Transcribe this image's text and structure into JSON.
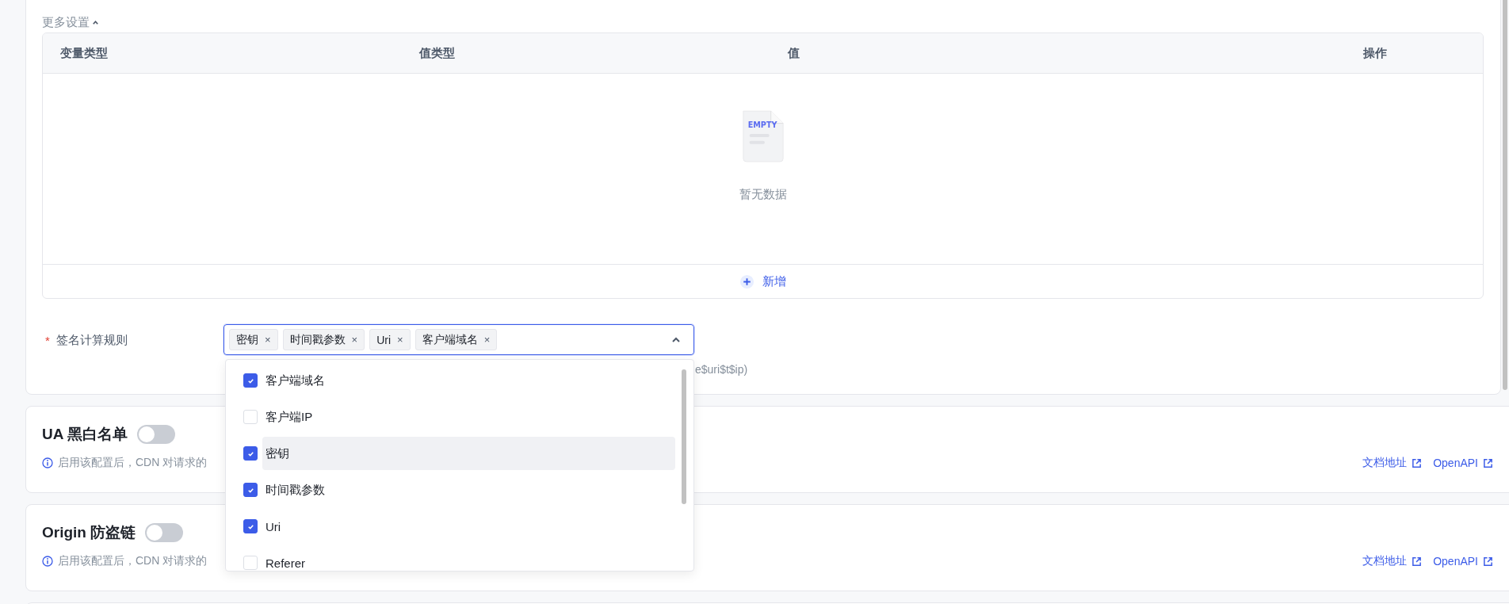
{
  "more_settings": {
    "label": "更多设置",
    "expanded": true
  },
  "table": {
    "columns": [
      "变量类型",
      "值类型",
      "值",
      "操作"
    ],
    "empty_text": "暂无数据",
    "empty_icon_text": "EMPTY",
    "add_label": "新增"
  },
  "signature_rule": {
    "required_mark": "*",
    "label": "签名计算规则",
    "tags": [
      {
        "label": "密钥",
        "remove": "×"
      },
      {
        "label": "时间戳参数",
        "remove": "×"
      },
      {
        "label": "Uri",
        "remove": "×"
      },
      {
        "label": "客户端域名",
        "remove": "×"
      }
    ],
    "expanded": true,
    "hint": "e$uri$t$ip)",
    "options": [
      {
        "label": "客户端域名",
        "checked": true,
        "highlighted": false
      },
      {
        "label": "客户端IP",
        "checked": false,
        "highlighted": false
      },
      {
        "label": "密钥",
        "checked": true,
        "highlighted": true
      },
      {
        "label": "时间戳参数",
        "checked": true,
        "highlighted": false
      },
      {
        "label": "Uri",
        "checked": true,
        "highlighted": false
      },
      {
        "label": "Referer",
        "checked": false,
        "highlighted": false
      }
    ]
  },
  "sections": [
    {
      "title": "UA 黑白名单",
      "on": false,
      "info": "启用该配置后，CDN 对请求的",
      "links": [
        "文档地址",
        "OpenAPI"
      ]
    },
    {
      "title": "Origin 防盗链",
      "on": false,
      "info": "启用该配置后，CDN 对请求的",
      "links": [
        "文档地址",
        "OpenAPI"
      ]
    }
  ]
}
